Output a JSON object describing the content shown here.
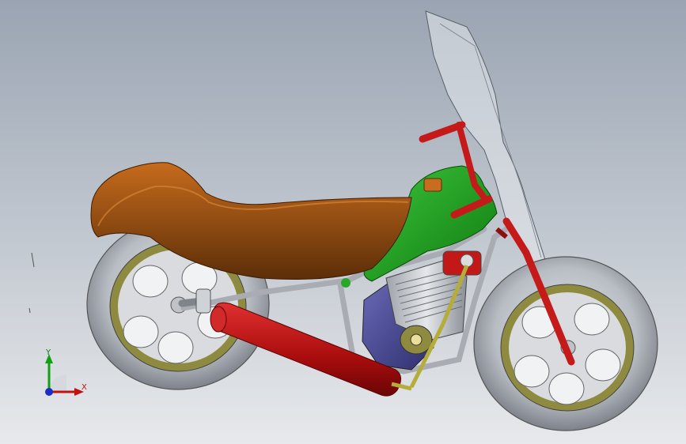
{
  "viewport": {
    "background_top": "#9aa4b2",
    "background_bottom": "#e7e9ec"
  },
  "model": {
    "parts": [
      "rear-wheel",
      "front-wheel",
      "seat",
      "fuel-tank",
      "engine",
      "exhaust",
      "handlebar",
      "windshield",
      "frame",
      "front-fork",
      "rear-shock"
    ],
    "colors": {
      "seat": "#8a4a12",
      "fuel_tank": "#1d9a1d",
      "exhaust": "#b01010",
      "handlebar": "#c01818",
      "engine": "#4a4a9a",
      "tire": "#b7bcc3",
      "rim": "#8e8a40",
      "frame": "#a9adb3"
    }
  },
  "triad": {
    "x_label": "X",
    "y_label": "Y",
    "icons": [
      "x-axis-arrow-icon",
      "y-axis-arrow-icon",
      "z-axis-dot-icon"
    ]
  }
}
